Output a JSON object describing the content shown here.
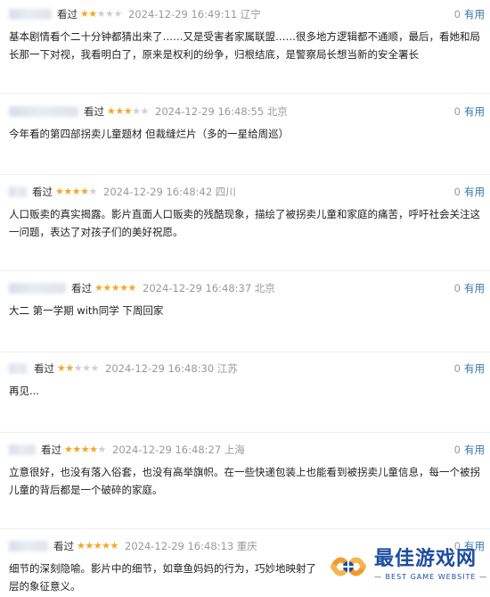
{
  "reviews": [
    {
      "watched": "看过",
      "rating": 2,
      "time": "2024-12-29 16:49:11",
      "location": "辽宁",
      "useful_count": "0",
      "useful_label": "有用",
      "text": "基本剧情看个二十分钟都猜出来了……又是受害者家属联盟……很多地方逻辑都不通顺，最后，看她和局长那一下对视，我看明白了，原来是权利的纷争，归根结底，是警察局长想当新的安全署长"
    },
    {
      "watched": "看过",
      "rating": 3,
      "time": "2024-12-29 16:48:55",
      "location": "北京",
      "useful_count": "0",
      "useful_label": "有用",
      "text": "今年看的第四部拐卖儿童题材 但裁缝烂片（多的一星给周巡）"
    },
    {
      "watched": "看过",
      "rating": 4,
      "time": "2024-12-29 16:48:42",
      "location": "四川",
      "useful_count": "0",
      "useful_label": "有用",
      "text": "人口贩卖的真实揭露。影片直面人口贩卖的残酷现象，描绘了被拐卖儿童和家庭的痛苦，呼吁社会关注这一问题，表达了对孩子们的美好祝愿。"
    },
    {
      "watched": "看过",
      "rating": 5,
      "time": "2024-12-29 16:48:37",
      "location": "北京",
      "useful_count": "0",
      "useful_label": "有用",
      "text": "大二 第一学期 with同学 下周回家"
    },
    {
      "watched": "看过",
      "rating": 2,
      "time": "2024-12-29 16:48:30",
      "location": "江苏",
      "useful_count": "0",
      "useful_label": "有用",
      "text": "再见..."
    },
    {
      "watched": "看过",
      "rating": 4,
      "time": "2024-12-29 16:48:27",
      "location": "上海",
      "useful_count": "0",
      "useful_label": "有用",
      "text": "立意很好，也没有落入俗套，也没有高举旗帜。在一些快递包装上也能看到被拐卖儿童信息，每一个被拐儿童的背后都是一个破碎的家庭。"
    },
    {
      "watched": "看过",
      "rating": 5,
      "time": "2024-12-29 16:48:13",
      "location": "重庆",
      "useful_count": "0",
      "useful_label": "有用",
      "text": "细节的深刻隐喻。影片中的细节，如章鱼妈妈的行为，巧妙地映射了层的象征意义。"
    }
  ],
  "watermark": {
    "title": "最佳游戏网",
    "subtitle": "BEST GAME WEBSITE"
  },
  "colors": {
    "star": "#f5a623",
    "star_empty": "#cfcfcf",
    "link": "#3377aa",
    "watermark": "#1e4da1"
  }
}
